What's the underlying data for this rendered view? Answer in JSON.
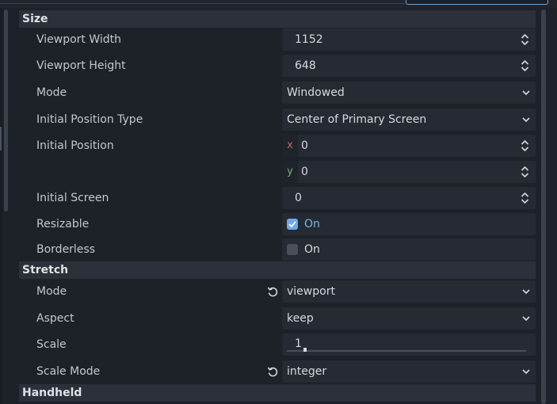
{
  "sections": [
    {
      "title": "Size"
    },
    {
      "title": "Stretch"
    },
    {
      "title": "Handheld"
    }
  ],
  "size": {
    "viewport_width": {
      "label": "Viewport Width",
      "value": "1152"
    },
    "viewport_height": {
      "label": "Viewport Height",
      "value": "648"
    },
    "mode": {
      "label": "Mode",
      "value": "Windowed"
    },
    "initial_position_type": {
      "label": "Initial Position Type",
      "value": "Center of Primary Screen"
    },
    "initial_position": {
      "label": "Initial Position",
      "x_axis": "x",
      "x_value": "0",
      "y_axis": "y",
      "y_value": "0"
    },
    "initial_screen": {
      "label": "Initial Screen",
      "value": "0"
    },
    "resizable": {
      "label": "Resizable",
      "checked": true,
      "text": "On"
    },
    "borderless": {
      "label": "Borderless",
      "checked": false,
      "text": "On"
    }
  },
  "stretch": {
    "mode": {
      "label": "Mode",
      "value": "viewport"
    },
    "aspect": {
      "label": "Aspect",
      "value": "keep"
    },
    "scale": {
      "label": "Scale",
      "value": "1",
      "fraction": 0.07
    },
    "scale_mode": {
      "label": "Scale Mode",
      "value": "integer"
    }
  },
  "icons": {
    "revert": "revert-icon",
    "spin": "up-down-arrows-icon",
    "dropdown": "chevron-down-icon",
    "checkbox": "checkbox-icon"
  },
  "colors": {
    "accent": "#6ea8f0",
    "axis_x": "#c66a5f",
    "axis_y": "#78b07a",
    "section_bg": "#2b303a",
    "field_bg": "#262b33"
  }
}
